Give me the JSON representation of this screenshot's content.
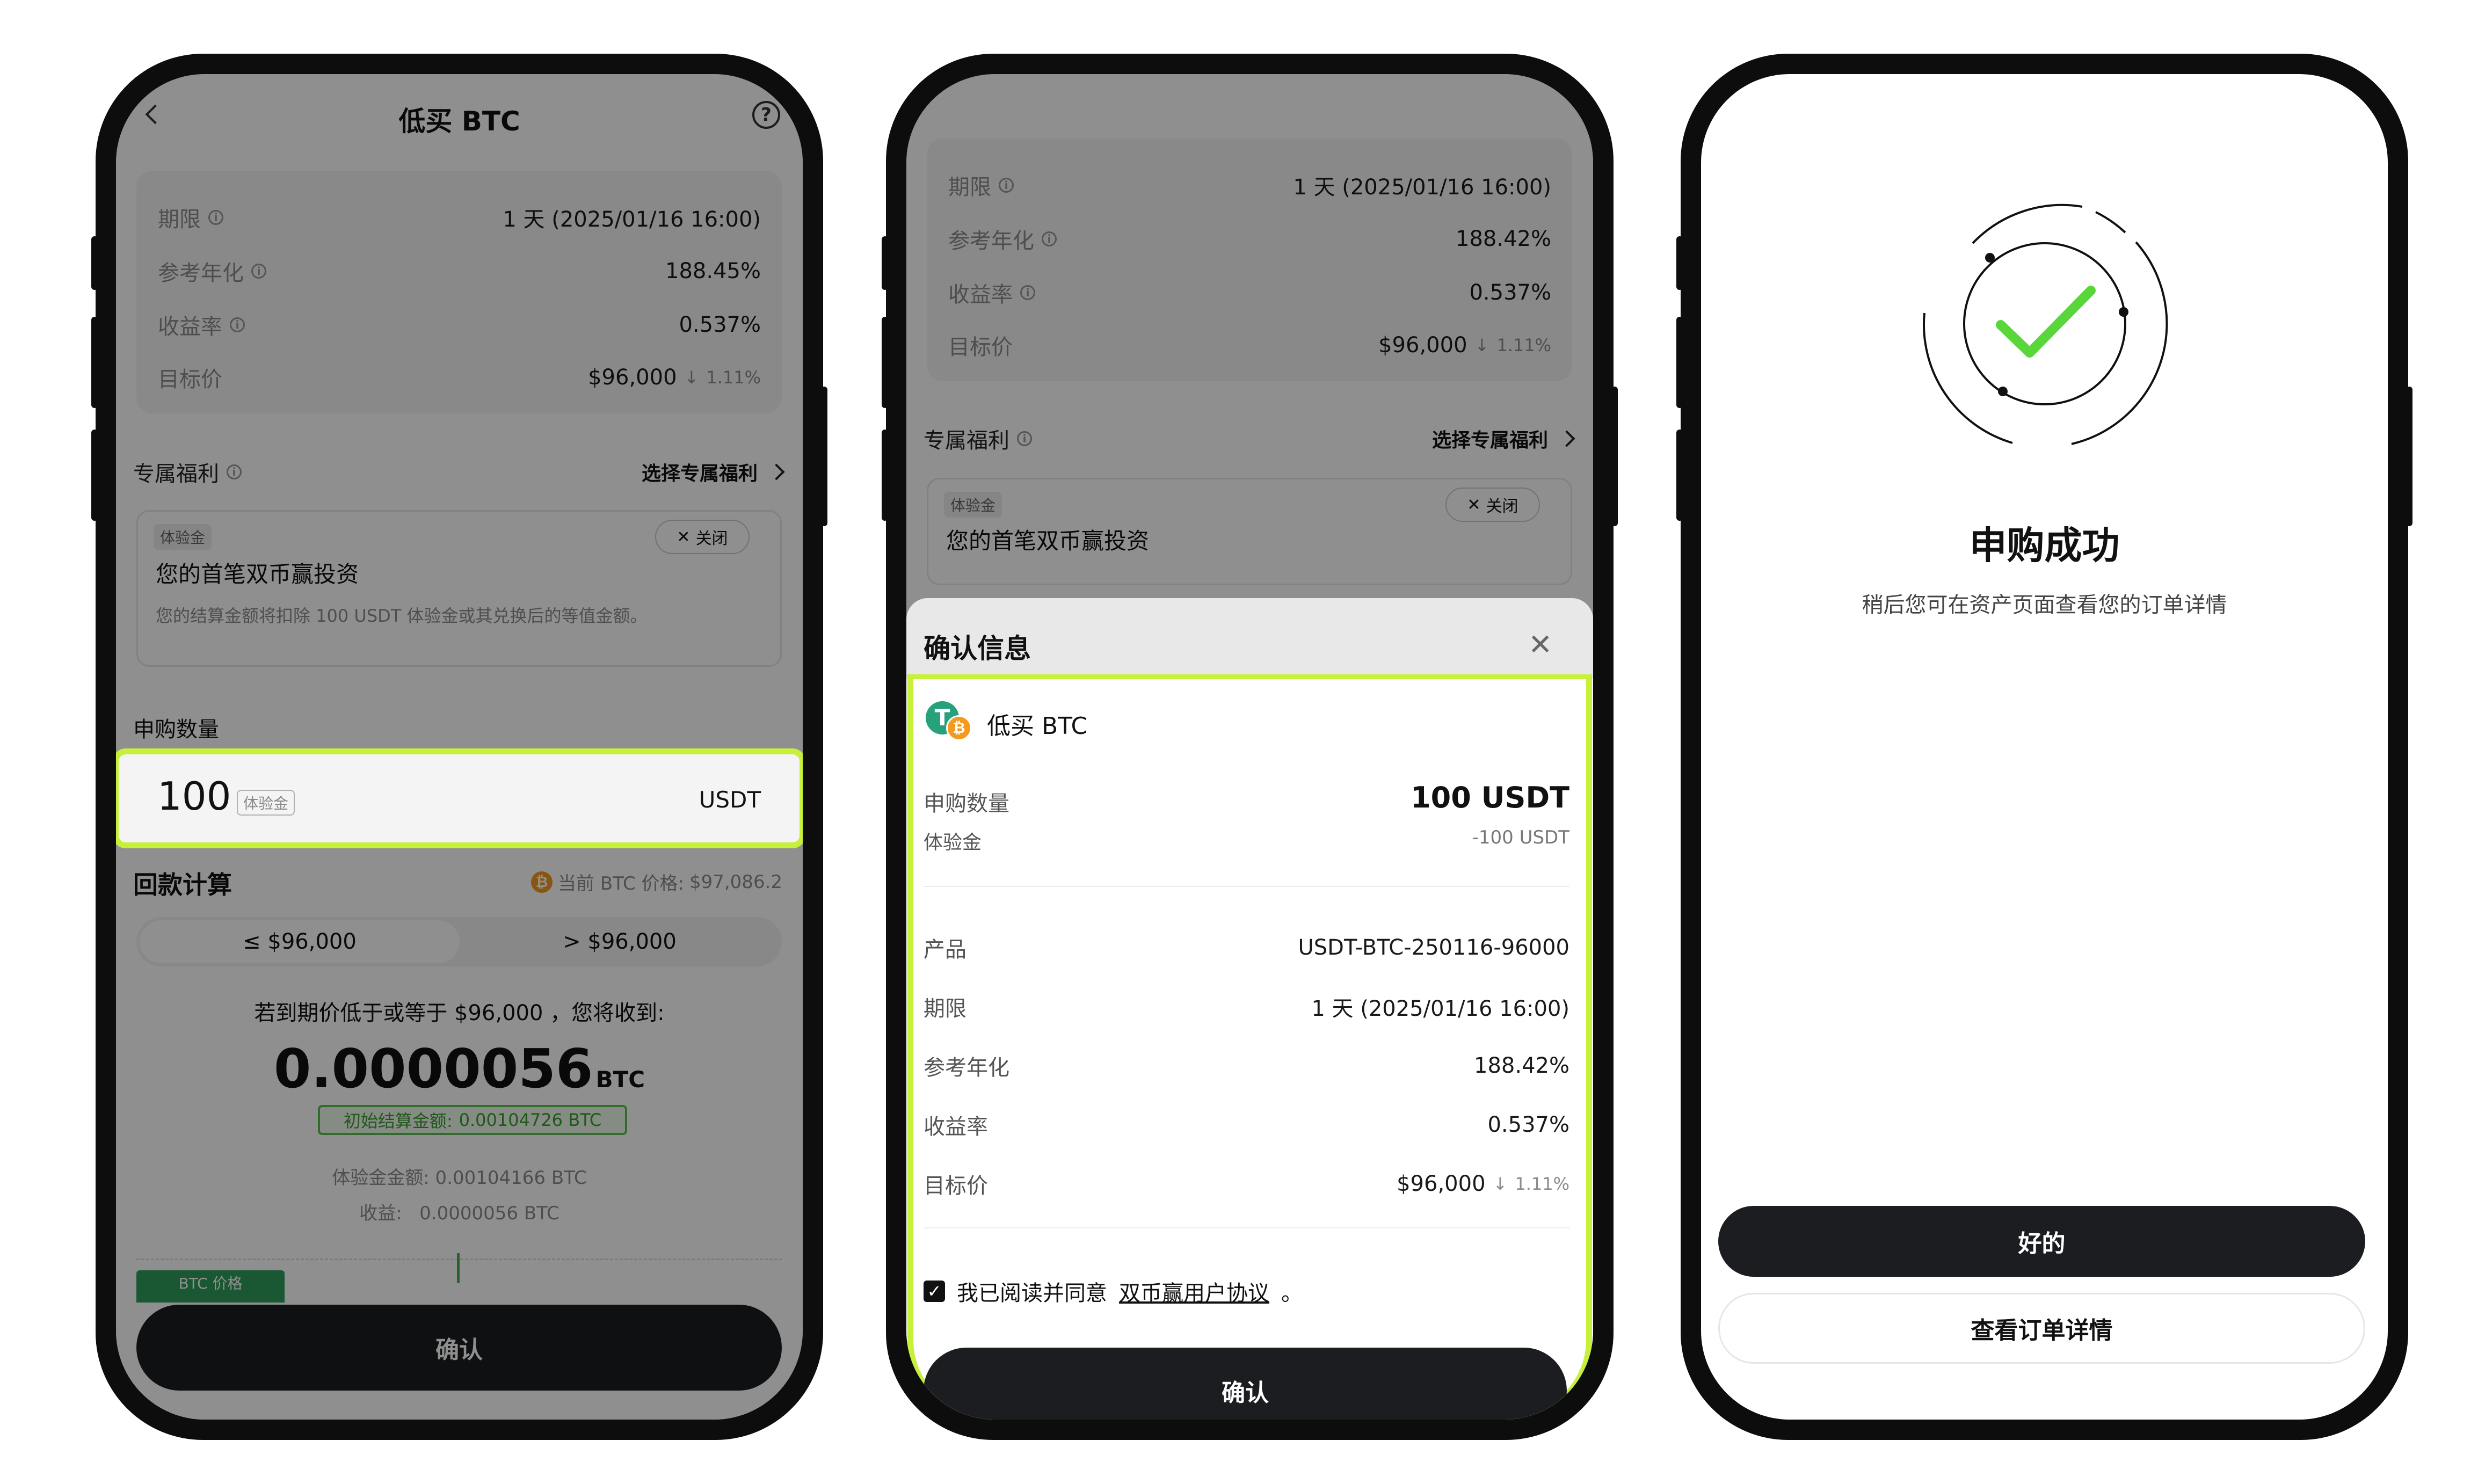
{
  "p1": {
    "title": "低买 BTC",
    "details": [
      {
        "label": "期限",
        "value": "1 天 (2025/01/16 16:00)"
      },
      {
        "label": "参考年化",
        "value": "188.45%"
      },
      {
        "label": "收益率",
        "value": "0.537%"
      },
      {
        "label": "目标价",
        "value": "$96,000",
        "change": "1.11%"
      }
    ],
    "benefit_title": "专属福利",
    "benefit_select": "选择专属福利",
    "benefit_tag": "体验金",
    "benefit_close": "关闭",
    "benefit_headline": "您的首笔双币赢投资",
    "benefit_desc": "您的结算金额将扣除 100 USDT 体验金或其兑换后的等值金额。",
    "amount_label": "申购数量",
    "amount_value": "100",
    "amount_tag": "体验金",
    "amount_unit": "USDT",
    "payback_title": "回款计算",
    "price_prefix": "当前 BTC 价格:",
    "price_value": "$97,086.2",
    "seg_left": "≤ $96,000",
    "seg_right": "> $96,000",
    "receive_text": "若到期价低于或等于 $96,000 ，您将收到:",
    "big_value": "0.0000056",
    "big_unit": "BTC",
    "initial_label": "初始结算金额:",
    "initial_value": "0.00104726 BTC",
    "trial_line": "体验金金额: 0.00104166 BTC",
    "earn_line": "收益:   0.0000056 BTC",
    "btc_price_tag": "BTC 价格",
    "confirm": "确认"
  },
  "p2": {
    "bg_details": [
      {
        "label": "期限",
        "value": "1 天 (2025/01/16 16:00)"
      },
      {
        "label": "参考年化",
        "value": "188.42%"
      },
      {
        "label": "收益率",
        "value": "0.537%"
      },
      {
        "label": "目标价",
        "value": "$96,000",
        "change": "1.11%"
      }
    ],
    "bg_benefit_title": "专属福利",
    "bg_benefit_select": "选择专属福利",
    "bg_tag": "体验金",
    "bg_close": "关闭",
    "bg_headline": "您的首笔双币赢投资",
    "sheet_title": "确认信息",
    "product_name": "低买 BTC",
    "amount_label": "申购数量",
    "amount_value": "100 USDT",
    "trial_label": "体验金",
    "trial_value": "-100 USDT",
    "rows": [
      {
        "label": "产品",
        "value": "USDT-BTC-250116-96000"
      },
      {
        "label": "期限",
        "value": "1 天 (2025/01/16 16:00)"
      },
      {
        "label": "参考年化",
        "value": "188.42%"
      },
      {
        "label": "收益率",
        "value": "0.537%"
      },
      {
        "label": "目标价",
        "value": "$96,000",
        "change": "1.11%"
      }
    ],
    "agree_prefix": "我已阅读并同意",
    "agree_link": "双币赢用户协议",
    "agree_suffix": "。",
    "confirm": "确认"
  },
  "p3": {
    "title": "申购成功",
    "subtitle": "稍后您可在资产页面查看您的订单详情",
    "ok": "好的",
    "view_order": "查看订单详情"
  },
  "colors": {
    "highlight": "#c6f03a",
    "check": "#58d63a",
    "dark_button": "#1b1d20",
    "btc": "#f39a1f",
    "usdt": "#26a17b"
  }
}
